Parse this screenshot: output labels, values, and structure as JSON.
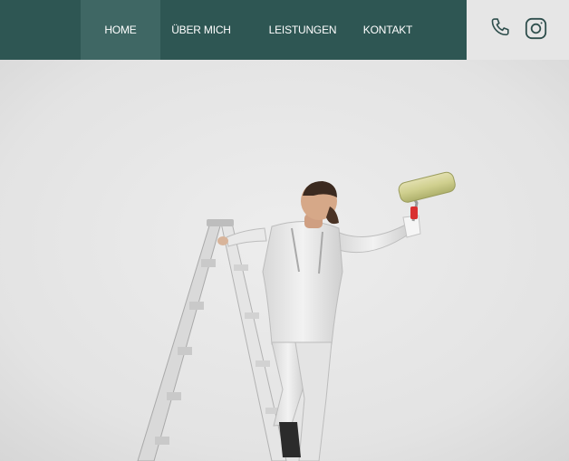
{
  "nav": {
    "items": [
      {
        "label": "HOME"
      },
      {
        "label": "ÜBER MICH"
      },
      {
        "label": "LEISTUNGEN"
      },
      {
        "label": "KONTAKT"
      }
    ]
  },
  "icons": {
    "phone": "phone-icon",
    "instagram": "instagram-icon"
  },
  "hero": {
    "image": "painter-on-ladder-with-paint-roller"
  },
  "colors": {
    "nav_background": "#2e5653",
    "nav_active": "#3f6764",
    "icon_bar_background": "#e6e6e6",
    "icon_stroke": "#2f4f4d",
    "wall": "#e9e9e9"
  }
}
